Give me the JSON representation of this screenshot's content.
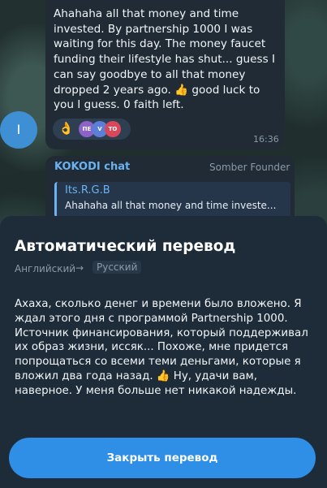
{
  "message": {
    "text": "Ahahaha all that money and time invested. By partnership 1000 I was waiting for this day. The money faucet funding their lifestyle has shut... guess I can say goodbye to all that money dropped 2 years ago. 👍 good luck to you I guess. 0 faith left.",
    "reaction_emoji": "👌",
    "reaction_avatars": [
      {
        "label": "ПЕ",
        "color": "#8e63c9"
      },
      {
        "label": "V",
        "color": "#5b7fd9"
      },
      {
        "label": "ТО",
        "color": "#d9475b"
      }
    ],
    "time": "16:36",
    "sender_initial": "I"
  },
  "next_message": {
    "chat_name": "KOKODI chat",
    "role": "Somber Founder",
    "quote_author": "Its.R.G.B",
    "quote_text": "Ahahaha all that money and time investe..."
  },
  "sheet": {
    "title": "Автоматический перевод",
    "from_lang": "Английский",
    "arrow": "→",
    "to_lang": "Русский",
    "translation": "Ахаха, сколько денег и времени было вложено. Я ждал этого дня с программой Partnership 1000. Источник финансирования, который поддерживал их образ жизни, иссяк... Похоже, мне придется попрощаться со всеми теми деньгами, которые я вложил два года назад. 👍 Ну, удачи вам, наверное. У меня больше нет никакой надежды.",
    "close_button": "Закрыть перевод"
  },
  "colors": {
    "accent": "#2f8fe6",
    "link": "#6ab2f2",
    "sheet_bg": "#1e2c3a",
    "bubble_bg": "#202b36"
  }
}
